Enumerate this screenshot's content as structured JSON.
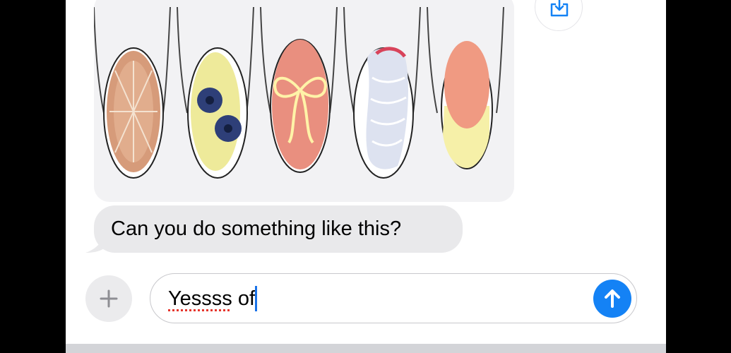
{
  "conversation": {
    "image_attachment": {
      "description_icon": "nail-design-photo-icon"
    },
    "share_button": {
      "icon": "share-icon"
    },
    "incoming_message": {
      "text": "Can you do something like this?"
    }
  },
  "composer": {
    "add_button": {
      "icon": "plus-icon"
    },
    "draft_word_1": "Yessss",
    "draft_word_2": " of",
    "send_button": {
      "icon": "arrow-up-icon",
      "color": "#1482f5"
    }
  },
  "colors": {
    "incoming_bubble": "#e9e9eb",
    "accent": "#1482f5",
    "spellcheck": "#e5352d"
  }
}
